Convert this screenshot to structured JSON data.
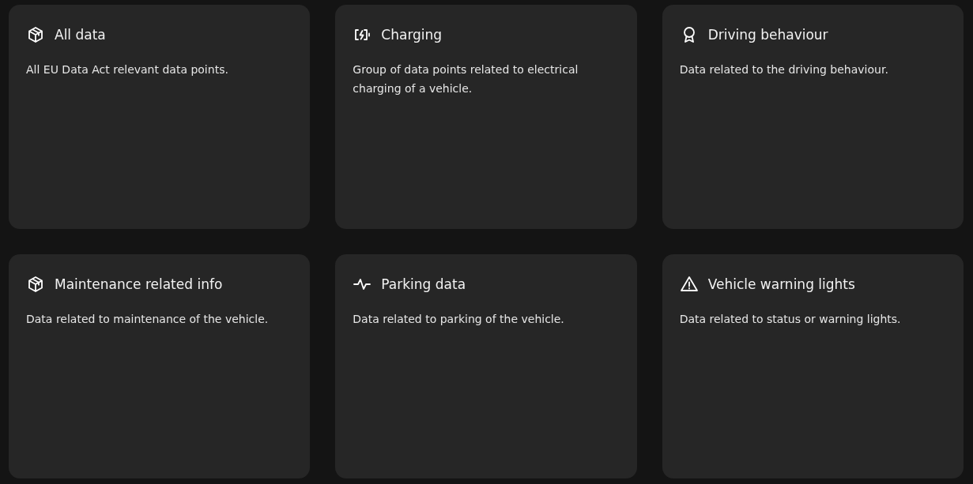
{
  "cards": [
    {
      "kind": "box",
      "title": "All data",
      "description": "All EU Data Act relevant data points."
    },
    {
      "kind": "battery",
      "title": "Charging",
      "description": "Group of data points related to electrical charging of a vehicle."
    },
    {
      "kind": "award",
      "title": "Driving behaviour",
      "description": "Data related to the driving behaviour."
    },
    {
      "kind": "box",
      "title": "Maintenance related info",
      "description": "Data related to maintenance of the vehicle."
    },
    {
      "kind": "pulse",
      "title": "Parking data",
      "description": "Data related to parking of the vehicle."
    },
    {
      "kind": "warning",
      "title": "Vehicle warning lights",
      "description": "Data related to status or warning lights."
    }
  ]
}
